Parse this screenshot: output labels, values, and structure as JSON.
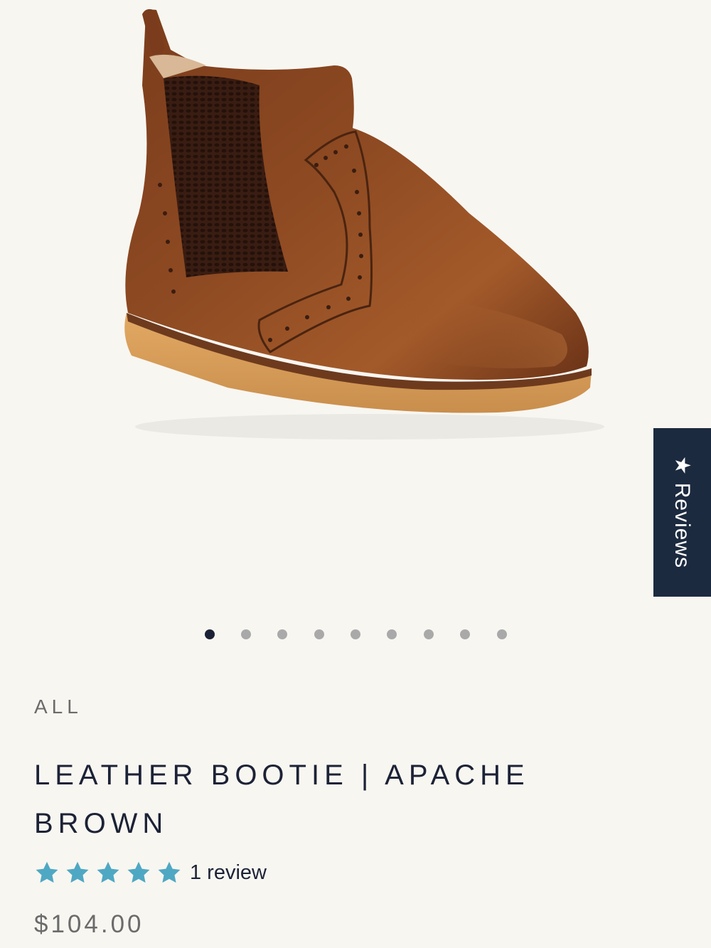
{
  "product": {
    "collection": "ALL",
    "title": "LEATHER BOOTIE | APACHE BROWN",
    "review_count_label": "1 review",
    "rating": 5,
    "rating_max": 5,
    "price": "$104.00"
  },
  "gallery": {
    "image_count": 9,
    "active_index": 0
  },
  "reviews_tab": {
    "icon": "star-icon",
    "label": "Reviews"
  },
  "colors": {
    "navy": "#1c2236",
    "reviews_tab_bg": "#1c2a3f",
    "star_teal": "#4fa8c3",
    "dot_inactive": "#a9a9a9",
    "background": "#f8f6f1"
  }
}
